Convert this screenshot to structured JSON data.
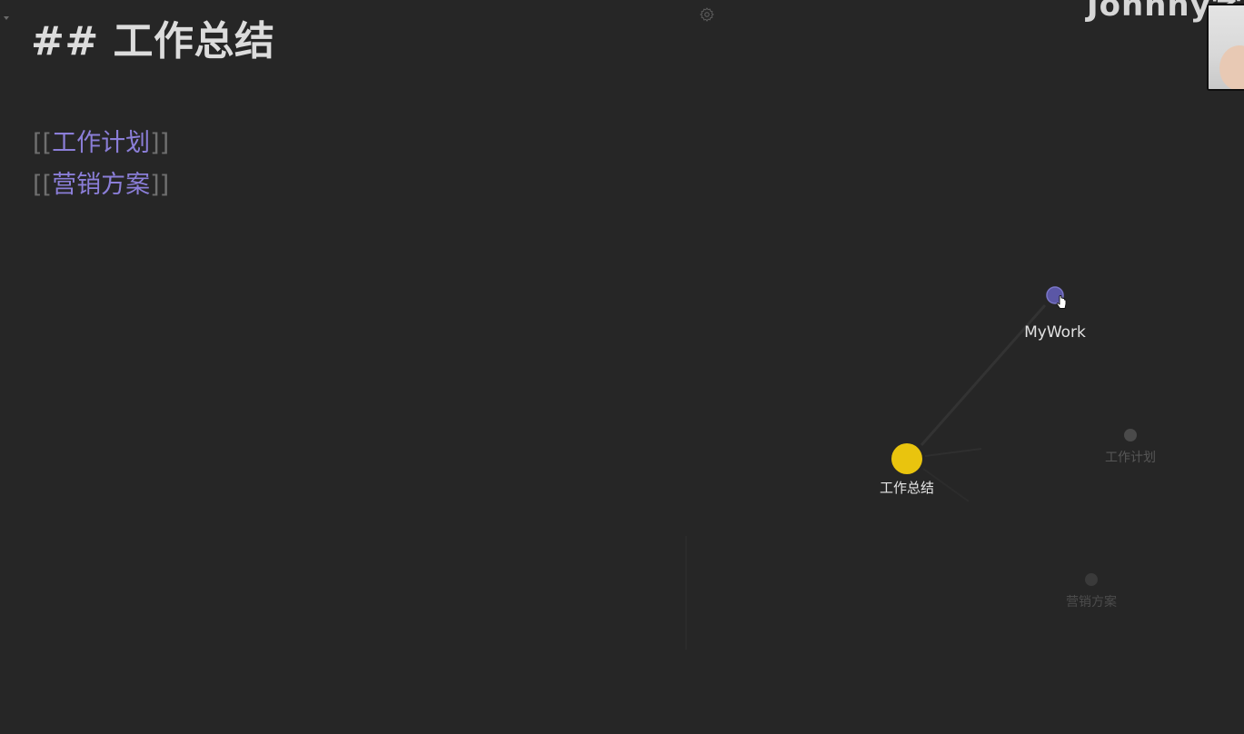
{
  "editor": {
    "heading": "## 工作总结",
    "links": [
      {
        "open": "[[",
        "text": "工作计划",
        "close": "]]"
      },
      {
        "open": "[[",
        "text": "营销方案",
        "close": "]]"
      }
    ]
  },
  "watermark": {
    "text": "Johnny学"
  },
  "graph": {
    "nodes": [
      {
        "id": "mywork",
        "label": "MyWork",
        "color": "#5b57a6",
        "state": "hovered"
      },
      {
        "id": "work-summary",
        "label": "工作总结",
        "color": "#e9c40e",
        "state": "active"
      },
      {
        "id": "work-plan",
        "label": "工作计划",
        "color": "#4a4a4a",
        "state": "dimmed"
      },
      {
        "id": "marketing-plan",
        "label": "营销方案",
        "color": "#3a3a3a",
        "state": "dimmed"
      }
    ],
    "links": [
      {
        "from": "work-summary",
        "to": "mywork"
      },
      {
        "from": "work-summary",
        "to": "work-plan"
      },
      {
        "from": "work-summary",
        "to": "marketing-plan"
      }
    ]
  },
  "icons": {
    "settings": "gear-icon",
    "cursor": "hand-pointer-icon",
    "fold": "fold-triangle-icon"
  }
}
